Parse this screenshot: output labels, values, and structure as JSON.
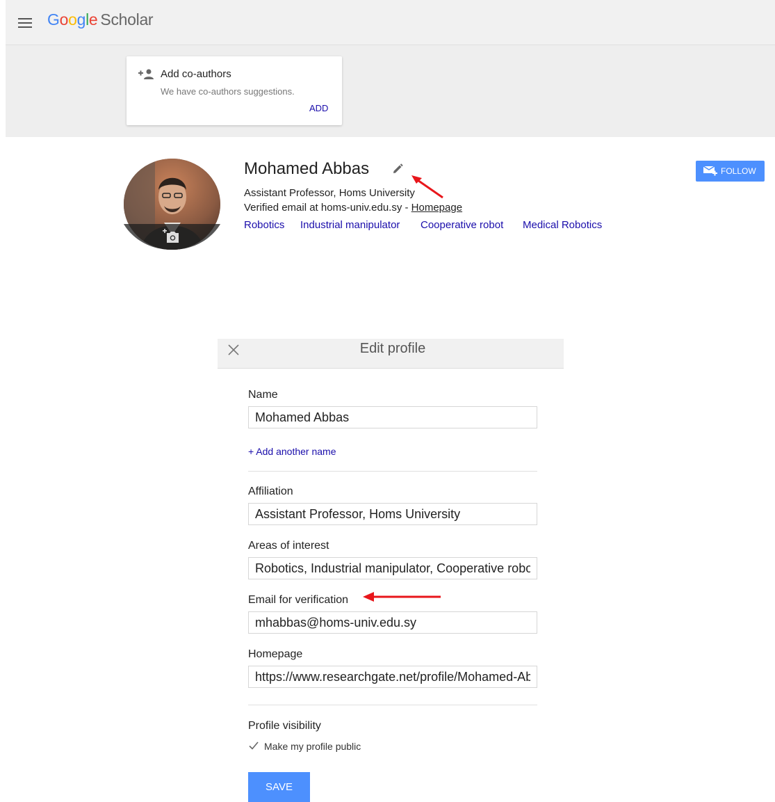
{
  "header": {
    "logo_google": [
      "G",
      "o",
      "o",
      "g",
      "l",
      "e"
    ],
    "logo_scholar": "Scholar"
  },
  "coauthors_card": {
    "title": "Add co-authors",
    "subtitle": "We have co-authors suggestions.",
    "add_label": "ADD"
  },
  "profile": {
    "name": "Mohamed Abbas",
    "affiliation": "Assistant Professor, Homs University",
    "verified_prefix": "Verified email at homs-univ.edu.sy - ",
    "homepage_link": "Homepage",
    "interests": [
      "Robotics",
      "Industrial manipulator",
      "Cooperative robot",
      "Medical Robotics"
    ],
    "follow_label": "FOLLOW"
  },
  "edit_profile": {
    "title": "Edit profile",
    "name_label": "Name",
    "name_value": "Mohamed Abbas",
    "add_name": "+ Add another name",
    "affiliation_label": "Affiliation",
    "affiliation_value": "Assistant Professor, Homs University",
    "interests_label": "Areas of interest",
    "interests_value": "Robotics, Industrial manipulator, Cooperative robot, Medical Robotics",
    "email_label": "Email for verification",
    "email_value": "mhabbas@homs-univ.edu.sy",
    "homepage_label": "Homepage",
    "homepage_value": "https://www.researchgate.net/profile/Mohamed-Abbas",
    "visibility_label": "Profile visibility",
    "public_label": "Make my profile public",
    "public_checked": true,
    "save_label": "SAVE"
  },
  "colors": {
    "link": "#1a0dab",
    "button_blue": "#4d90fe",
    "annotation_arrow": "#e8161b"
  }
}
